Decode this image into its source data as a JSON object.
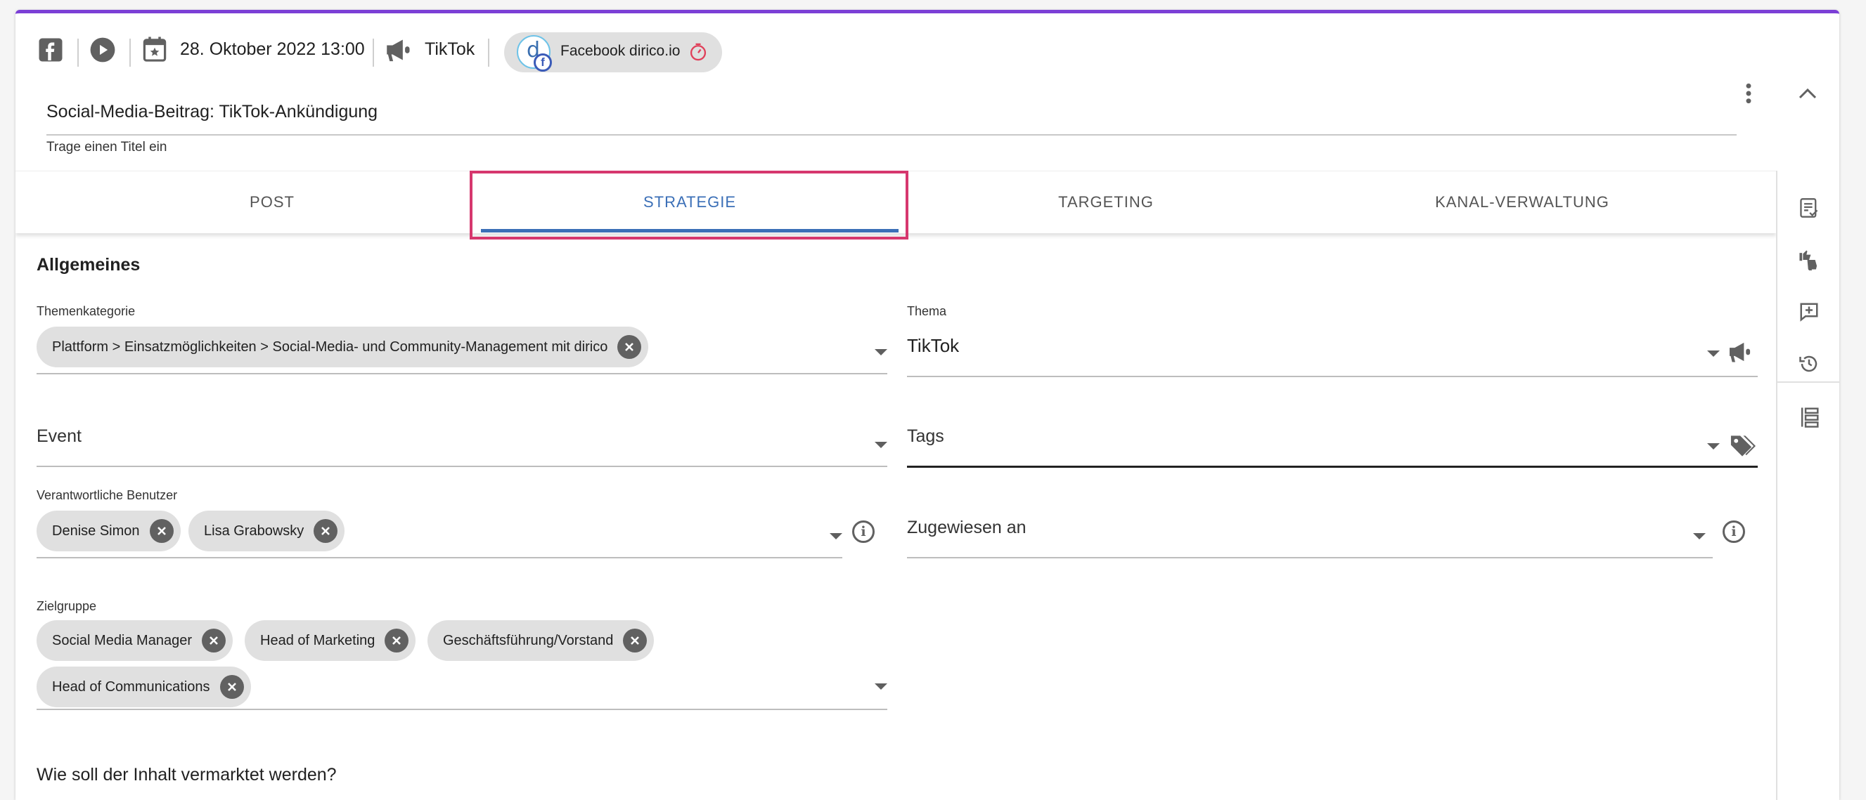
{
  "header": {
    "date": "28. Oktober 2022 13:00",
    "channel": "TikTok",
    "account_chip": "Facebook dirico.io",
    "avatar_letter": "d",
    "avatar_badge": "f",
    "title_value": "Social-Media-Beitrag: TikTok-Ankündigung",
    "title_hint": "Trage einen Titel ein"
  },
  "tabs": [
    {
      "label": "POST",
      "active": false
    },
    {
      "label": "STRATEGIE",
      "active": true
    },
    {
      "label": "TARGETING",
      "active": false
    },
    {
      "label": "KANAL-VERWALTUNG",
      "active": false
    }
  ],
  "form": {
    "section_title": "Allgemeines",
    "themenkategorie": {
      "label": "Themenkategorie",
      "chips": [
        "Plattform > Einsatzmöglichkeiten > Social-Media- und Community-Management mit dirico"
      ]
    },
    "thema": {
      "label": "Thema",
      "value": "TikTok"
    },
    "event": {
      "placeholder": "Event"
    },
    "tags": {
      "placeholder": "Tags"
    },
    "verantwortliche": {
      "label": "Verantwortliche Benutzer",
      "chips": [
        "Denise Simon",
        "Lisa Grabowsky"
      ]
    },
    "zugewiesen": {
      "placeholder": "Zugewiesen an"
    },
    "zielgruppe": {
      "label": "Zielgruppe",
      "chips": [
        "Social Media Manager",
        "Head of Marketing",
        "Geschäftsführung/Vorstand",
        "Head of Communications"
      ]
    },
    "question": "Wie soll der Inhalt vermarktet werden?"
  },
  "info_glyph": "i",
  "icons": {
    "facebook": "facebook-icon",
    "play": "play-circle-icon",
    "calendar": "calendar-star-icon",
    "megaphone": "megaphone-icon",
    "timer": "timer-icon",
    "more": "more-vert-icon",
    "collapse": "chevron-up-icon",
    "tag": "tag-icon"
  },
  "colors": {
    "accent_top": "#7b3fd6",
    "tab_active": "#3b6fb7",
    "highlight": "#d6376e",
    "chip_bg": "#e0e0e0"
  }
}
